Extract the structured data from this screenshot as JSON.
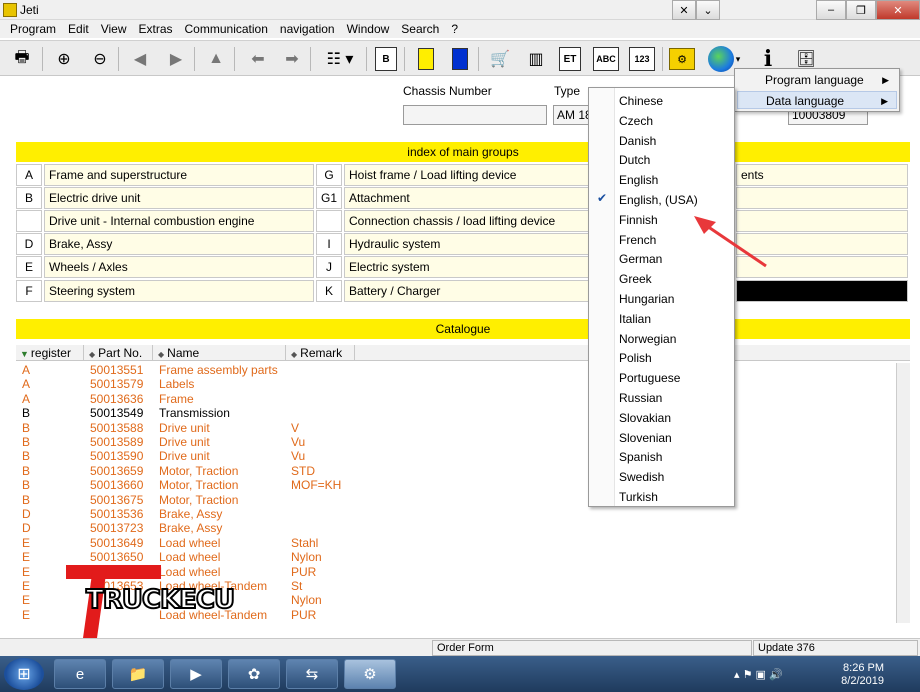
{
  "window": {
    "title": "Jeti"
  },
  "menubar": [
    "Program",
    "Edit",
    "View",
    "Extras",
    "Communication",
    "navigation",
    "Window",
    "Search",
    "?"
  ],
  "toolbar": {
    "icons": [
      "printer-icon",
      "zoom-in-icon",
      "zoom-out-icon",
      "prev-icon",
      "next-icon",
      "up-icon",
      "back-icon",
      "forward-icon",
      "tree-icon"
    ],
    "box_labels": {
      "b": "B",
      "et": "ET",
      "abc": "ABC",
      "n123": "123"
    }
  },
  "form": {
    "chassis_label": "Chassis Number",
    "chassis_value": "",
    "type_label": "Type",
    "type_value": "AM 18",
    "serial_value": "10003809"
  },
  "main_groups": {
    "title": "index of main groups",
    "rows": [
      {
        "code1": "A",
        "name1": "Frame and superstructure",
        "code2": "G",
        "name2": "Hoist frame / Load lifting device",
        "name3": "ents"
      },
      {
        "code1": "B",
        "name1": "Electric drive unit",
        "code2": "G1",
        "name2": "Attachment",
        "name3": ""
      },
      {
        "code1": "",
        "name1": "Drive unit - Internal combustion engine",
        "code2": "",
        "name2": "Connection chassis / load lifting device",
        "name3": ""
      },
      {
        "code1": "D",
        "name1": "Brake, Assy",
        "code2": "I",
        "name2": "Hydraulic system",
        "name3": ""
      },
      {
        "code1": "E",
        "name1": "Wheels / Axles",
        "code2": "J",
        "name2": "Electric system",
        "name3": ""
      },
      {
        "code1": "F",
        "name1": "Steering system",
        "code2": "K",
        "name2": "Battery / Charger",
        "name3": ""
      }
    ]
  },
  "catalogue": {
    "title": "Catalogue",
    "columns": [
      "register",
      "Part No.",
      "Name",
      "Remark"
    ],
    "rows": [
      {
        "register": "A",
        "part": "50013551",
        "name": "Frame assembly parts",
        "remark": "",
        "color": "orange"
      },
      {
        "register": "A",
        "part": "50013579",
        "name": "Labels",
        "remark": "",
        "color": "orange"
      },
      {
        "register": "A",
        "part": "50013636",
        "name": "Frame",
        "remark": "",
        "color": "orange"
      },
      {
        "register": "B",
        "part": "50013549",
        "name": "Transmission",
        "remark": "",
        "color": "black"
      },
      {
        "register": "B",
        "part": "50013588",
        "name": "Drive unit",
        "remark": "V",
        "color": "orange"
      },
      {
        "register": "B",
        "part": "50013589",
        "name": "Drive unit",
        "remark": "Vu",
        "color": "orange"
      },
      {
        "register": "B",
        "part": "50013590",
        "name": "Drive unit",
        "remark": "Vu",
        "color": "orange"
      },
      {
        "register": "B",
        "part": "50013659",
        "name": "Motor, Traction",
        "remark": "STD",
        "color": "orange"
      },
      {
        "register": "B",
        "part": "50013660",
        "name": "Motor, Traction",
        "remark": "MOF=KH",
        "color": "orange"
      },
      {
        "register": "B",
        "part": "50013675",
        "name": "Motor, Traction",
        "remark": "",
        "color": "orange"
      },
      {
        "register": "D",
        "part": "50013536",
        "name": "Brake, Assy",
        "remark": "",
        "color": "orange"
      },
      {
        "register": "D",
        "part": "50013723",
        "name": "Brake, Assy",
        "remark": "",
        "color": "orange"
      },
      {
        "register": "E",
        "part": "50013649",
        "name": "Load wheel",
        "remark": "Stahl",
        "color": "orange"
      },
      {
        "register": "E",
        "part": "50013650",
        "name": "Load wheel",
        "remark": "Nylon",
        "color": "orange"
      },
      {
        "register": "E",
        "part": "",
        "name": "Load wheel",
        "remark": "PUR",
        "color": "orange"
      },
      {
        "register": "E",
        "part": "50013653",
        "name": "Load wheel-Tandem",
        "remark": "St",
        "color": "orange"
      },
      {
        "register": "E",
        "part": "",
        "name": "",
        "remark": "Nylon",
        "color": "orange"
      },
      {
        "register": "E",
        "part": "",
        "name": "Load wheel-Tandem",
        "remark": "PUR",
        "color": "orange"
      }
    ]
  },
  "language_menu": {
    "selected": "English, (USA)",
    "items": [
      "Chinese",
      "Czech",
      "Danish",
      "Dutch",
      "English",
      "English, (USA)",
      "Finnish",
      "French",
      "German",
      "Greek",
      "Hungarian",
      "Italian",
      "Norwegian",
      "Polish",
      "Portuguese",
      "Russian",
      "Slovakian",
      "Slovenian",
      "Spanish",
      "Swedish",
      "Turkish"
    ]
  },
  "submenu": {
    "items": [
      "Program language",
      "Data language"
    ],
    "highlighted": "Data language"
  },
  "statusbar": {
    "order_form": "Order Form",
    "update": "Update 376"
  },
  "taskbar": {
    "time": "8:26 PM",
    "date": "8/2/2019"
  },
  "watermark": {
    "text": "TRUCKECU"
  },
  "colors": {
    "yellow": "#ffef00",
    "orange": "#e06a1b",
    "menu_highlight": "#dbe6f5",
    "arrow": "#e8383b"
  }
}
